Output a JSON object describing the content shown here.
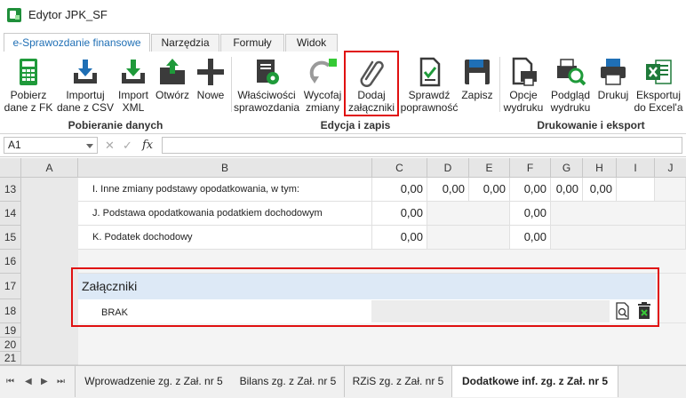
{
  "window": {
    "title": "Edytor JPK_SF"
  },
  "tabs": [
    {
      "label": "e-Sprawozdanie finansowe",
      "active": true
    },
    {
      "label": "Narzędzia"
    },
    {
      "label": "Formuły"
    },
    {
      "label": "Widok"
    }
  ],
  "ribbon": {
    "buttons": [
      {
        "label1": "Pobierz",
        "label2": "dane z FK",
        "icon": "calculator-icon"
      },
      {
        "label1": "Importuj",
        "label2": "dane z CSV",
        "icon": "import-csv-icon"
      },
      {
        "label1": "Import",
        "label2": "XML",
        "icon": "import-xml-icon"
      },
      {
        "label1": "Otwórz",
        "label2": "",
        "icon": "open-icon"
      },
      {
        "label1": "Nowe",
        "label2": "",
        "icon": "plus-icon"
      },
      {
        "label1": "Właściwości",
        "label2": "sprawozdania",
        "icon": "properties-icon"
      },
      {
        "label1": "Wycofaj",
        "label2": "zmiany",
        "icon": "undo-icon"
      },
      {
        "label1": "Dodaj",
        "label2": "załączniki",
        "icon": "paperclip-icon"
      },
      {
        "label1": "Sprawdź",
        "label2": "poprawność",
        "icon": "check-document-icon"
      },
      {
        "label1": "Zapisz",
        "label2": "",
        "icon": "save-icon"
      },
      {
        "label1": "Opcje",
        "label2": "wydruku",
        "icon": "print-options-icon"
      },
      {
        "label1": "Podgląd",
        "label2": "wydruku",
        "icon": "print-preview-icon"
      },
      {
        "label1": "Drukuj",
        "label2": "",
        "icon": "printer-icon"
      },
      {
        "label1": "Eksportuj",
        "label2": "do Excel'a",
        "icon": "excel-icon"
      }
    ],
    "groups": [
      {
        "label": "Pobieranie danych"
      },
      {
        "label": "Edycja i zapis"
      },
      {
        "label": "Drukowanie i eksport"
      }
    ],
    "colors": {
      "blue": "#1f6fb5",
      "green": "#1f9a3a",
      "dark": "#3b3b3b",
      "highlight": "#e01010"
    }
  },
  "formula_bar": {
    "cell_ref": "A1",
    "cancel": "✕",
    "confirm": "✓",
    "fx": "fx",
    "value": ""
  },
  "grid": {
    "columns": [
      "A",
      "B",
      "C",
      "D",
      "E",
      "F",
      "G",
      "H",
      "I",
      "J"
    ],
    "rows": [
      {
        "num": "13",
        "label": "I. Inne zmiany podstawy opodatkowania, w tym:",
        "C": "0,00",
        "D": "0,00",
        "E": "0,00",
        "F": "0,00",
        "G": "0,00",
        "H": "0,00"
      },
      {
        "num": "14",
        "label": "J. Podstawa opodatkowania podatkiem dochodowym",
        "C": "0,00",
        "F": "0,00"
      },
      {
        "num": "15",
        "label": "K. Podatek dochodowy",
        "C": "0,00",
        "F": "0,00"
      },
      {
        "num": "16"
      },
      {
        "num": "17"
      },
      {
        "num": "18"
      },
      {
        "num": "19"
      },
      {
        "num": "20"
      },
      {
        "num": "21"
      }
    ],
    "attachments": {
      "title": "Załączniki",
      "value": "BRAK",
      "preview_icon": "preview-document-icon",
      "delete_icon": "delete-icon"
    }
  },
  "sheet_tabs": [
    {
      "label": "Wprowadzenie zg. z Zał. nr 5"
    },
    {
      "label": "Bilans zg. z Zał. nr 5"
    },
    {
      "label": "RZiS zg. z Zał. nr 5"
    },
    {
      "label": "Dodatkowe inf. zg. z Zał. nr 5",
      "active": true
    }
  ]
}
